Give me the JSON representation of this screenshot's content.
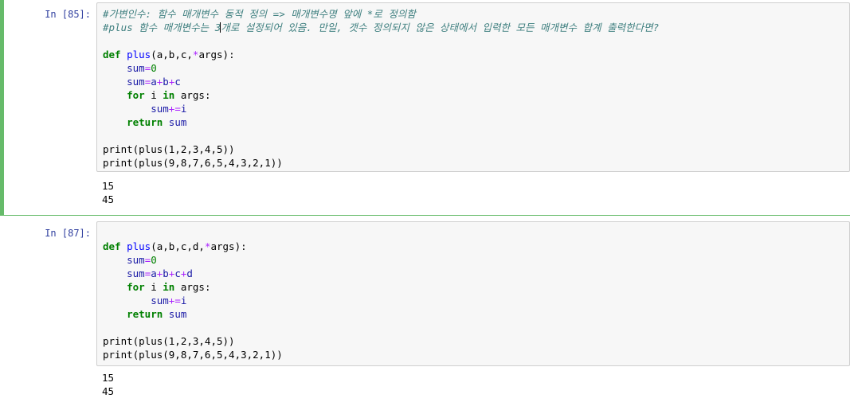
{
  "cells": [
    {
      "prompt": "In [85]:",
      "comment1": "#가변인수: 함수 매개변수 동적 정의 => 매개변수명 앞에 *로 정의함",
      "comment2_before_cursor": "#plus 함수 매개변수는 3",
      "comment2_after_cursor": "개로 설정되어 있음. 만일, 갯수 정의되지 않은 상태에서 입력한 모든 매개변수 합계 출력한다면?",
      "def_line": {
        "kw": "def",
        "name": "plus",
        "params": "(a,b,c,",
        "star": "*",
        "rest": "args):"
      },
      "sum_init": {
        "var": "sum",
        "op": "=",
        "num": "0"
      },
      "sum_assign": {
        "var": "sum",
        "eq": "=",
        "a": "a",
        "p1": "+",
        "b": "b",
        "p2": "+",
        "c": "c",
        "p3": "",
        "d": ""
      },
      "for_line": {
        "kw_for": "for",
        "var": " i ",
        "kw_in": "in",
        "rest": " args:"
      },
      "sum_inc": {
        "var": "sum",
        "op": "+=",
        "val": "i"
      },
      "return_line": {
        "kw": "return",
        "val": "sum"
      },
      "print1": "print(plus(1,2,3,4,5))",
      "print2": "print(plus(9,8,7,6,5,4,3,2,1))",
      "outputs": [
        "15",
        "45"
      ]
    },
    {
      "prompt": "In [87]:",
      "def_line": {
        "kw": "def",
        "name": "plus",
        "params": "(a,b,c,d,",
        "star": "*",
        "rest": "args):"
      },
      "sum_init": {
        "var": "sum",
        "op": "=",
        "num": "0"
      },
      "sum_assign": {
        "var": "sum",
        "eq": "=",
        "a": "a",
        "p1": "+",
        "b": "b",
        "p2": "+",
        "c": "c",
        "p3": "+",
        "d": "d"
      },
      "for_line": {
        "kw_for": "for",
        "var": " i ",
        "kw_in": "in",
        "rest": " args:"
      },
      "sum_inc": {
        "var": "sum",
        "op": "+=",
        "val": "i"
      },
      "return_line": {
        "kw": "return",
        "val": "sum"
      },
      "print1": "print(plus(1,2,3,4,5))",
      "print2": "print(plus(9,8,7,6,5,4,3,2,1))",
      "outputs": [
        "15",
        "45"
      ]
    }
  ]
}
